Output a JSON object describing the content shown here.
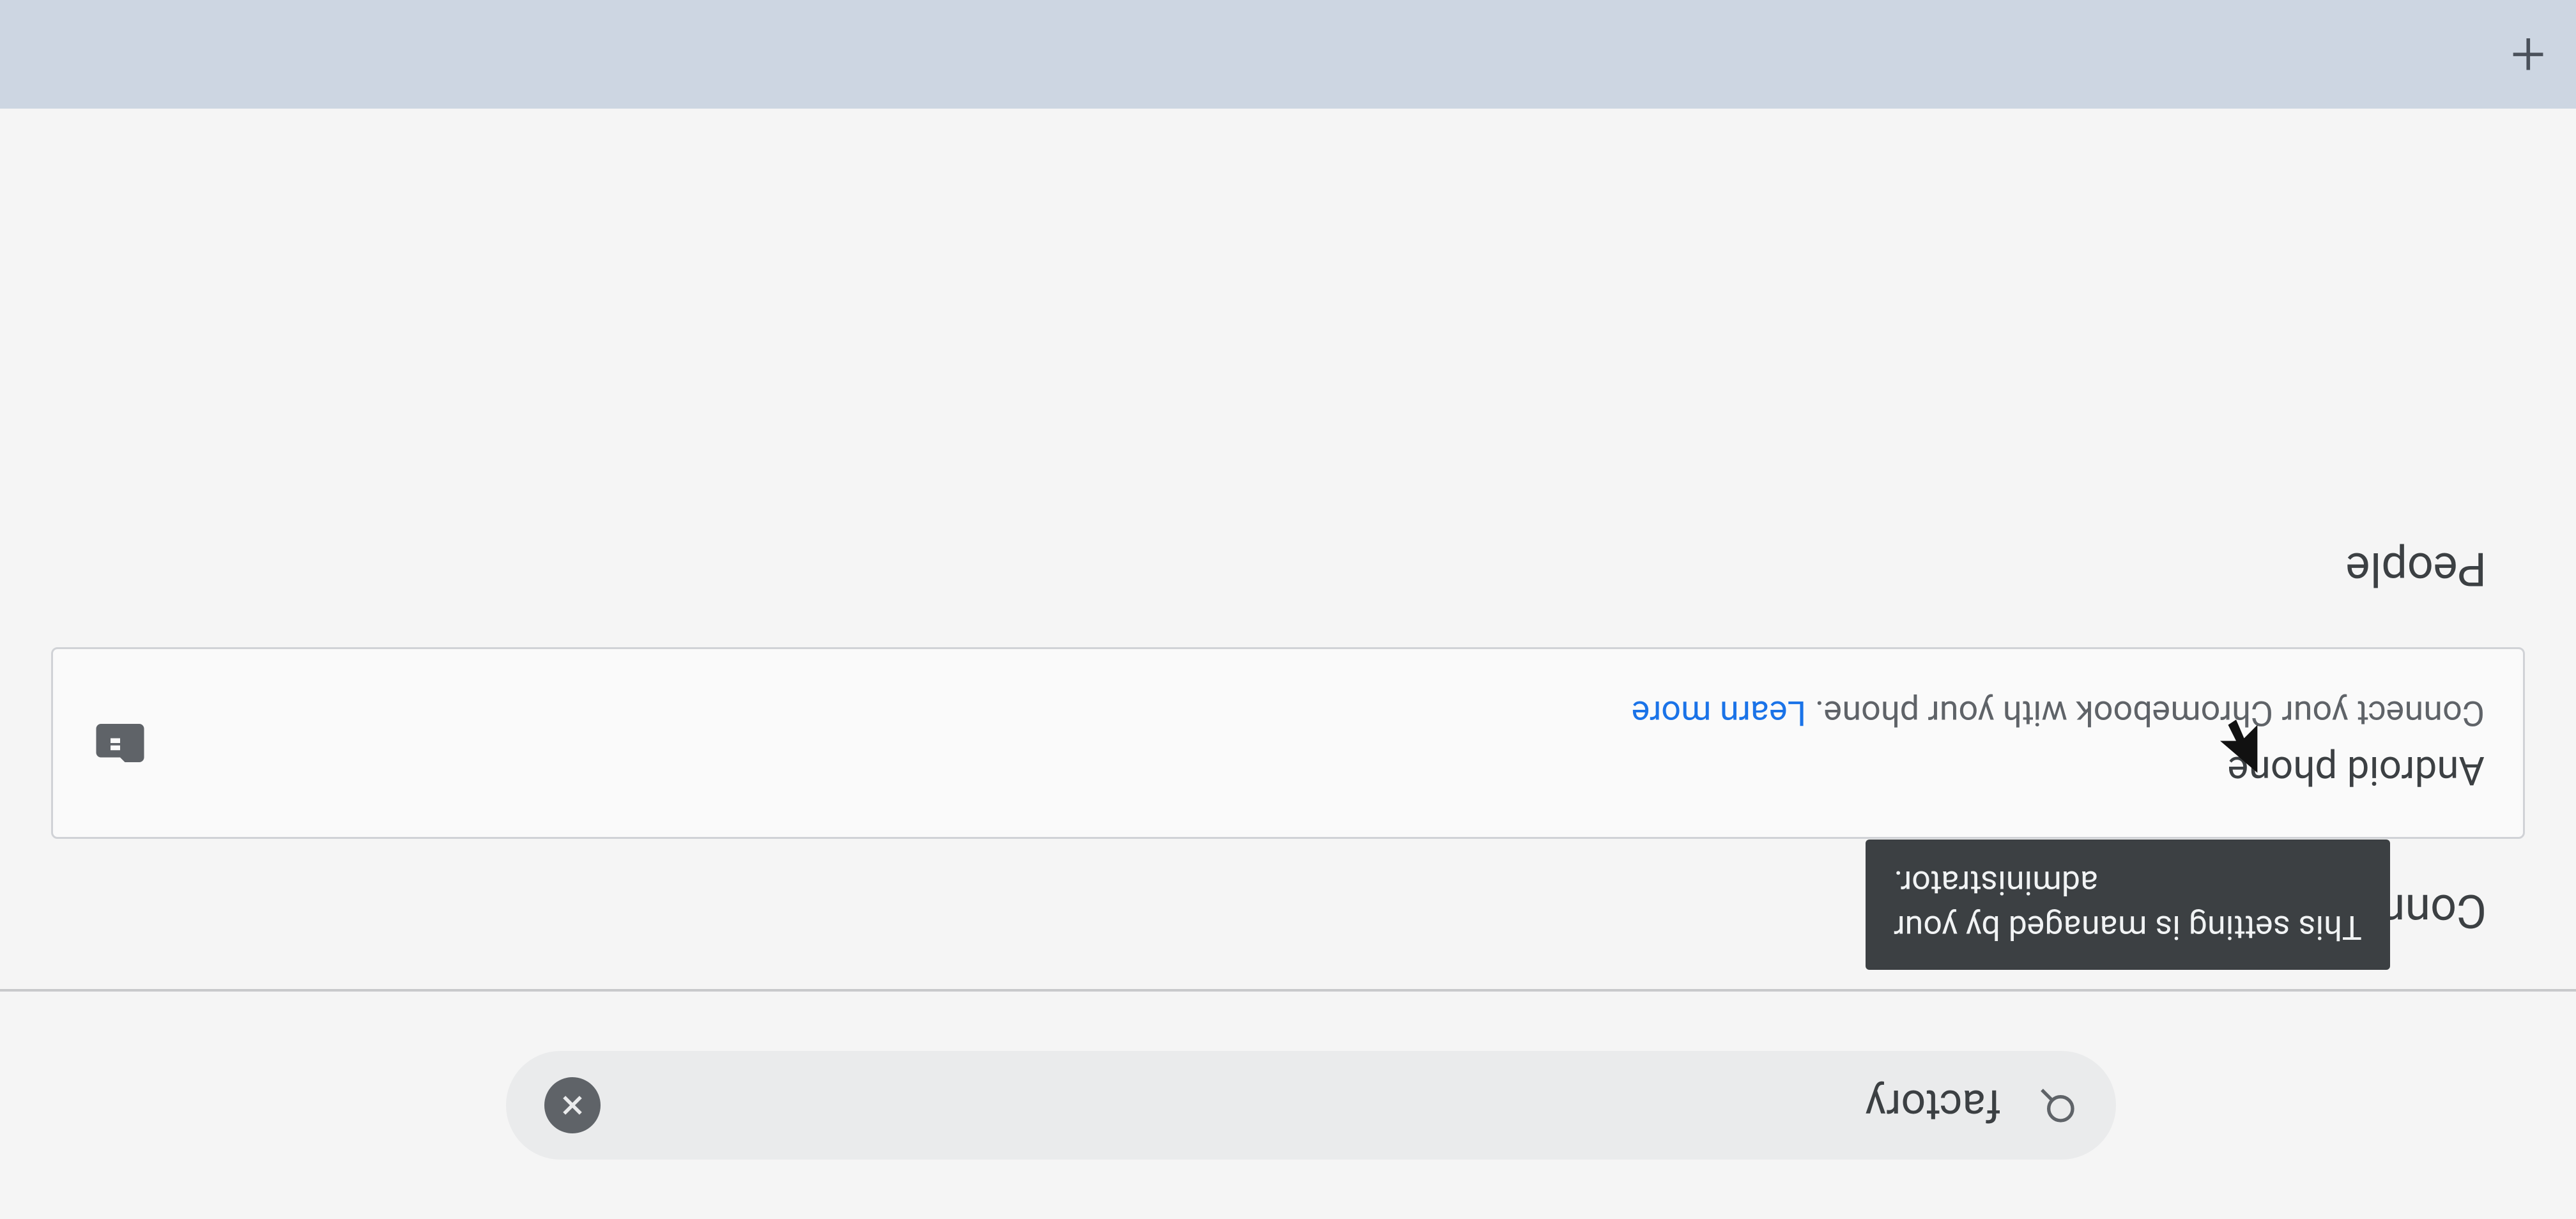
{
  "tabstrip": {
    "new_tab_glyph": "+"
  },
  "search": {
    "value": "factory",
    "icon_name": "search-icon",
    "clear_icon_name": "close-icon"
  },
  "sections": {
    "connected_devices": {
      "title": "Connected devices",
      "card": {
        "title": "Android phone",
        "subtitle_plain": "Connect your Chromebook with your phone.",
        "subtitle_link": "Learn more",
        "managed_icon_name": "managed-icon"
      }
    },
    "people": {
      "title": "People"
    }
  },
  "tooltip": {
    "text": "This setting is managed by your\nadministrator."
  },
  "colors": {
    "link": "#1a73e8",
    "text_primary": "#3c4043",
    "text_secondary": "#5f6368",
    "tooltip_bg": "#3c4043"
  }
}
